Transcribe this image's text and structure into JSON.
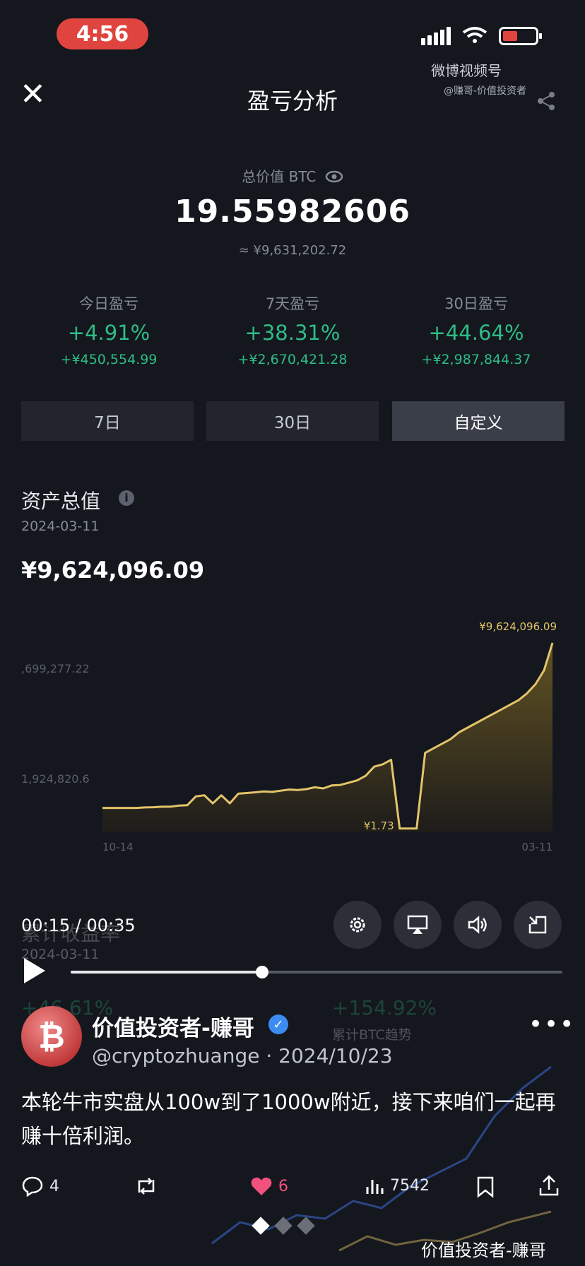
{
  "status_bar": {
    "time": "4:56"
  },
  "watermark": {
    "brand": "微博视频号",
    "account": "@赚哥-价值投资者"
  },
  "header": {
    "title": "盈亏分析"
  },
  "summary": {
    "total_label": "总价值 BTC",
    "total_btc": "19.55982606",
    "total_cny": "≈ ¥9,631,202.72"
  },
  "stats": [
    {
      "label": "今日盈亏",
      "pct": "+4.91%",
      "amount": "+¥450,554.99"
    },
    {
      "label": "7天盈亏",
      "pct": "+38.31%",
      "amount": "+¥2,670,421.28"
    },
    {
      "label": "30日盈亏",
      "pct": "+44.64%",
      "amount": "+¥2,987,844.37"
    }
  ],
  "tabs": [
    {
      "label": "7日",
      "active": false
    },
    {
      "label": "30日",
      "active": false
    },
    {
      "label": "自定义",
      "active": true
    }
  ],
  "asset": {
    "title": "资产总值",
    "date": "2024-03-11",
    "value": "¥9,624,096.09"
  },
  "chart_data": {
    "type": "area",
    "title": "",
    "x_tick_labels": [
      "10-14",
      "03-11"
    ],
    "y_tick_labels": [
      ",699,277.22",
      "1,924,820.6"
    ],
    "annotations": {
      "max_label": "¥9,624,096.09",
      "min_label": "¥1.73"
    },
    "series": [
      {
        "values": [
          1.0,
          1.0,
          1.0,
          1.0,
          1.0,
          1.02,
          1.03,
          1.05,
          1.05,
          1.1,
          1.12,
          1.5,
          1.55,
          1.2,
          1.55,
          1.2,
          1.62,
          1.65,
          1.68,
          1.72,
          1.7,
          1.75,
          1.8,
          1.78,
          1.82,
          1.9,
          1.85,
          1.98,
          2.0,
          2.1,
          2.2,
          2.4,
          2.8,
          2.9,
          3.1,
          0.1,
          0.1,
          0.1,
          3.4,
          3.6,
          3.8,
          4.0,
          4.3,
          4.5,
          4.7,
          4.9,
          5.1,
          5.3,
          5.5,
          5.7,
          6.0,
          6.4,
          7.0,
          8.2
        ]
      }
    ],
    "colors": {
      "line": "#e3c46a",
      "fill_top": "#6e5c24",
      "fill_bottom": "#1f1d1a"
    }
  },
  "video": {
    "time": "00:15 / 00:35",
    "progress": 0.39
  },
  "ghost": {
    "title": "累计收益率",
    "date": "2024-03-11",
    "pct_left": "+46.61%",
    "pct_right": "+154.92%",
    "legend": "累计BTC趋势"
  },
  "post": {
    "author": "价值投资者-赚哥",
    "handle": "@cryptozhuange · 2024/10/23",
    "text": "本轮牛市实盘从100w到了1000w附近，接下来咱们一起再赚十倍利润。",
    "replies": "4",
    "likes": "6",
    "views": "7542"
  },
  "bottom_watermark": "价值投资者-赚哥"
}
